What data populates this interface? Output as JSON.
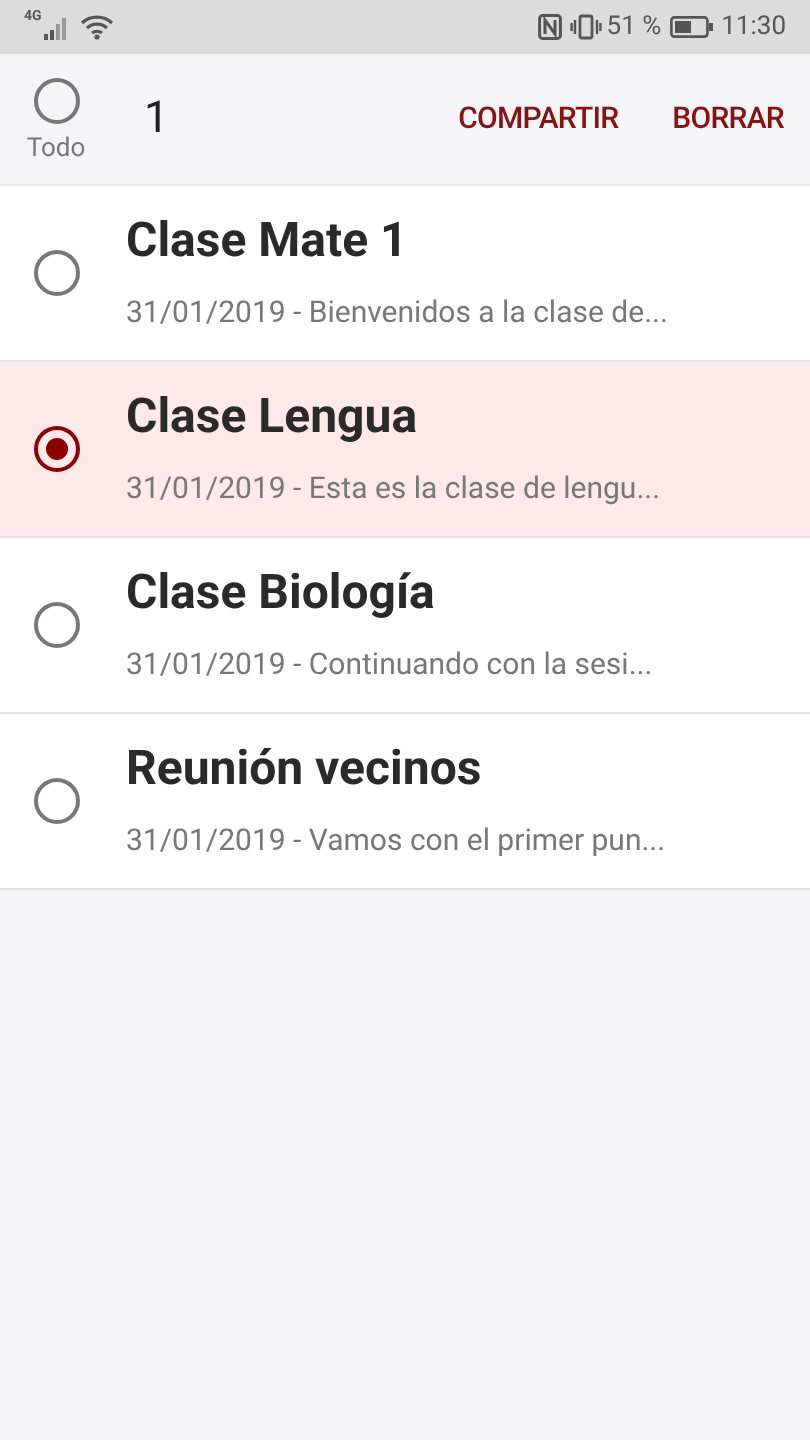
{
  "status_bar": {
    "network": "4G",
    "battery_percent": "51 %",
    "time": "11:30"
  },
  "toolbar": {
    "select_all": {
      "label": "Todo",
      "selected": false
    },
    "count": "1",
    "actions": [
      "COMPARTIR",
      "BORRAR"
    ]
  },
  "notes": [
    {
      "title": "Clase Mate 1",
      "subtitle": "31/01/2019 - Bienvenidos a la clase de...",
      "selected": false
    },
    {
      "title": "Clase Lengua",
      "subtitle": "31/01/2019 - Esta es la clase de lengu...",
      "selected": true
    },
    {
      "title": "Clase Biología",
      "subtitle": "31/01/2019 - Continuando con la sesi...",
      "selected": false
    },
    {
      "title": "Reunión vecinos",
      "subtitle": "31/01/2019 - Vamos con el primer pun...",
      "selected": false
    }
  ]
}
